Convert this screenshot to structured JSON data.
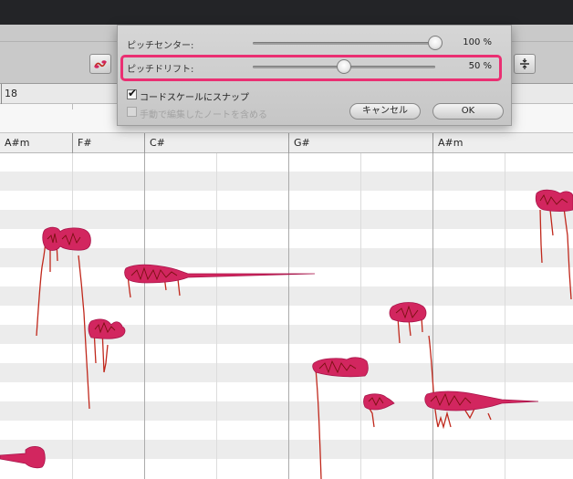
{
  "dialog": {
    "pitch_center_label": "ピッチセンター:",
    "pitch_center_value": "100 %",
    "pitch_center_level": 1.0,
    "pitch_drift_label": "ピッチドリフト:",
    "pitch_drift_value": "50 %",
    "pitch_drift_level": 0.5,
    "highlight_color": "#ea2f72",
    "snap_chord_scale_label": "コードスケールにスナップ",
    "snap_chord_scale_checked": true,
    "include_manual_notes_label": "手動で編集したノートを含める",
    "include_manual_notes_checked": false,
    "include_manual_notes_enabled": false,
    "cancel_label": "キャンセル",
    "ok_label": "OK"
  },
  "ruler": {
    "bar_number": "18"
  },
  "chords": [
    "A#m",
    "F#",
    "C#",
    "G#",
    "A#m"
  ],
  "toolbar": {
    "left_icon": "note-tool-icon",
    "right_icon": "split-tool-icon"
  },
  "colors": {
    "note_blob": "#d2265f",
    "note_blob_edge": "#a8144a",
    "pitch_curve": "#c0281c",
    "accent": "#ea2f72"
  }
}
